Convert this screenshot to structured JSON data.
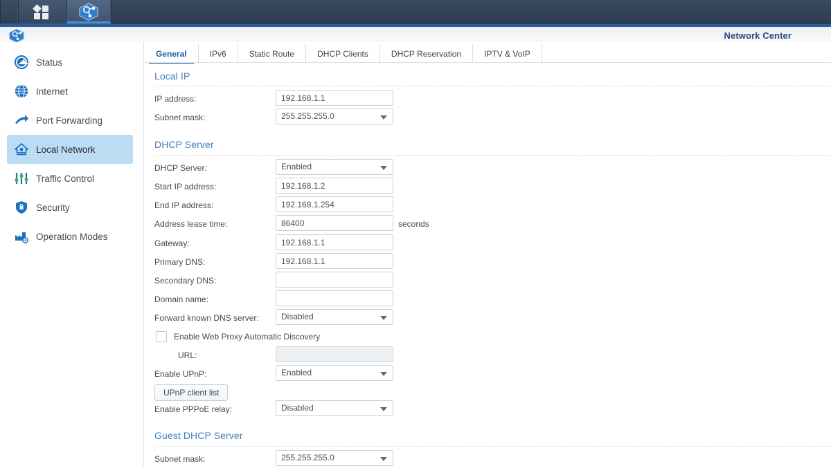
{
  "taskbar": {
    "apps_button": "apps-grid-icon",
    "active_app": "network-center-icon"
  },
  "header": {
    "title": "Network Center",
    "icon": "network-center-icon"
  },
  "sidebar": {
    "items": [
      {
        "label": "Status",
        "icon": "gauge-icon",
        "selected": false
      },
      {
        "label": "Internet",
        "icon": "globe-icon",
        "selected": false
      },
      {
        "label": "Port Forwarding",
        "icon": "arrow-icon",
        "selected": false
      },
      {
        "label": "Local Network",
        "icon": "home-icon",
        "selected": true
      },
      {
        "label": "Traffic Control",
        "icon": "sliders-icon",
        "selected": false
      },
      {
        "label": "Security",
        "icon": "shield-icon",
        "selected": false
      },
      {
        "label": "Operation Modes",
        "icon": "factory-icon",
        "selected": false
      }
    ]
  },
  "tabs": [
    {
      "label": "General",
      "active": true
    },
    {
      "label": "IPv6",
      "active": false
    },
    {
      "label": "Static Route",
      "active": false
    },
    {
      "label": "DHCP Clients",
      "active": false
    },
    {
      "label": "DHCP Reservation",
      "active": false
    },
    {
      "label": "IPTV & VoIP",
      "active": false
    }
  ],
  "sections": {
    "local_ip": {
      "title": "Local IP",
      "ip_address_label": "IP address:",
      "ip_address_value": "192.168.1.1",
      "subnet_mask_label": "Subnet mask:",
      "subnet_mask_value": "255.255.255.0"
    },
    "dhcp_server": {
      "title": "DHCP Server",
      "dhcp_server_label": "DHCP Server:",
      "dhcp_server_value": "Enabled",
      "start_ip_label": "Start IP address:",
      "start_ip_value": "192.168.1.2",
      "end_ip_label": "End IP address:",
      "end_ip_value": "192.168.1.254",
      "lease_time_label": "Address lease time:",
      "lease_time_value": "86400",
      "lease_time_unit": "seconds",
      "gateway_label": "Gateway:",
      "gateway_value": "192.168.1.1",
      "primary_dns_label": "Primary DNS:",
      "primary_dns_value": "192.168.1.1",
      "secondary_dns_label": "Secondary DNS:",
      "secondary_dns_value": "",
      "domain_name_label": "Domain name:",
      "domain_name_value": "",
      "forward_dns_label": "Forward known DNS server:",
      "forward_dns_value": "Disabled",
      "wpad_checkbox_label": "Enable Web Proxy Automatic Discovery",
      "wpad_checked": false,
      "url_label": "URL:",
      "url_value": "",
      "upnp_label": "Enable UPnP:",
      "upnp_value": "Enabled",
      "upnp_client_list_button": "UPnP client list",
      "pppoe_label": "Enable PPPoE relay:",
      "pppoe_value": "Disabled"
    },
    "guest_dhcp_server": {
      "title": "Guest DHCP Server",
      "subnet_mask_label": "Subnet mask:",
      "subnet_mask_value": "255.255.255.0"
    }
  },
  "colors": {
    "accent_blue": "#2f73bb",
    "section_title": "#3e7cb8",
    "selected_nav": "#bcdcf3",
    "taskbar": "#33435a",
    "header_bar": "#2c5c95"
  }
}
